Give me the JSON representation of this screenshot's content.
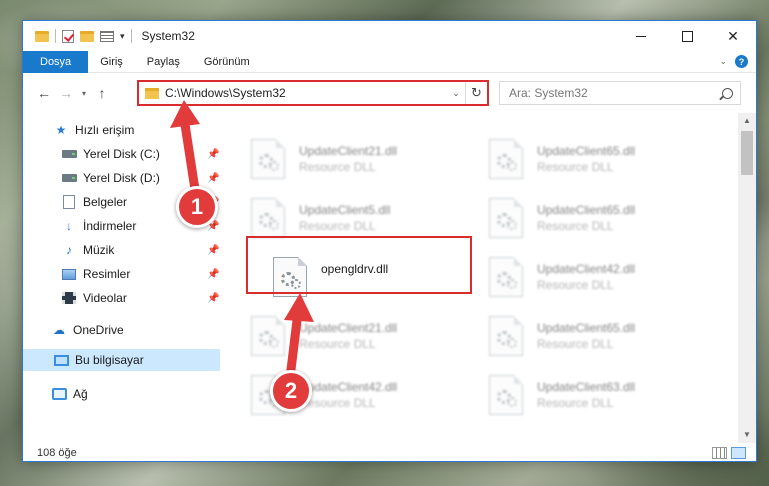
{
  "window": {
    "title": "System32",
    "close_glyph": "✕"
  },
  "ribbon": {
    "tabs": [
      "Dosya",
      "Giriş",
      "Paylaş",
      "Görünüm"
    ]
  },
  "address": {
    "path": "C:\\Windows\\System32",
    "search_placeholder": "Ara: System32"
  },
  "nav": {
    "quick_access": "Hızlı erişim",
    "items": [
      {
        "label": "Yerel Disk (C:)",
        "icon": "disk-icon"
      },
      {
        "label": "Yerel Disk (D:)",
        "icon": "disk-icon"
      },
      {
        "label": "Belgeler",
        "icon": "documents-icon"
      },
      {
        "label": "İndirmeler",
        "icon": "downloads-icon"
      },
      {
        "label": "Müzik",
        "icon": "music-icon"
      },
      {
        "label": "Resimler",
        "icon": "pictures-icon"
      },
      {
        "label": "Videolar",
        "icon": "videos-icon"
      }
    ],
    "onedrive": "OneDrive",
    "this_pc": "Bu bilgisayar",
    "network": "Ağ"
  },
  "files": [
    {
      "name": "UpdateClient21.dll",
      "type": "Resource DLL"
    },
    {
      "name": "UpdateClient65.dll",
      "type": "Resource DLL"
    },
    {
      "name": "UpdateClient5.dll",
      "type": "Resource DLL"
    },
    {
      "name": "UpdateClient65.dll",
      "type": "Resource DLL"
    },
    {
      "name": "opengldrv.dll",
      "type": ""
    },
    {
      "name": "UpdateClient42.dll",
      "type": "Resource DLL"
    },
    {
      "name": "UpdateClient21.dll",
      "type": "Resource DLL"
    },
    {
      "name": "UpdateClient65.dll",
      "type": "Resource DLL"
    },
    {
      "name": "UpdateClient42.dll",
      "type": "Resource DLL"
    },
    {
      "name": "UpdateClient63.dll",
      "type": "Resource DLL"
    }
  ],
  "status": {
    "item_count": "108 öğe"
  },
  "annotations": {
    "marker1": "1",
    "marker2": "2",
    "color": "#e23b3b"
  }
}
